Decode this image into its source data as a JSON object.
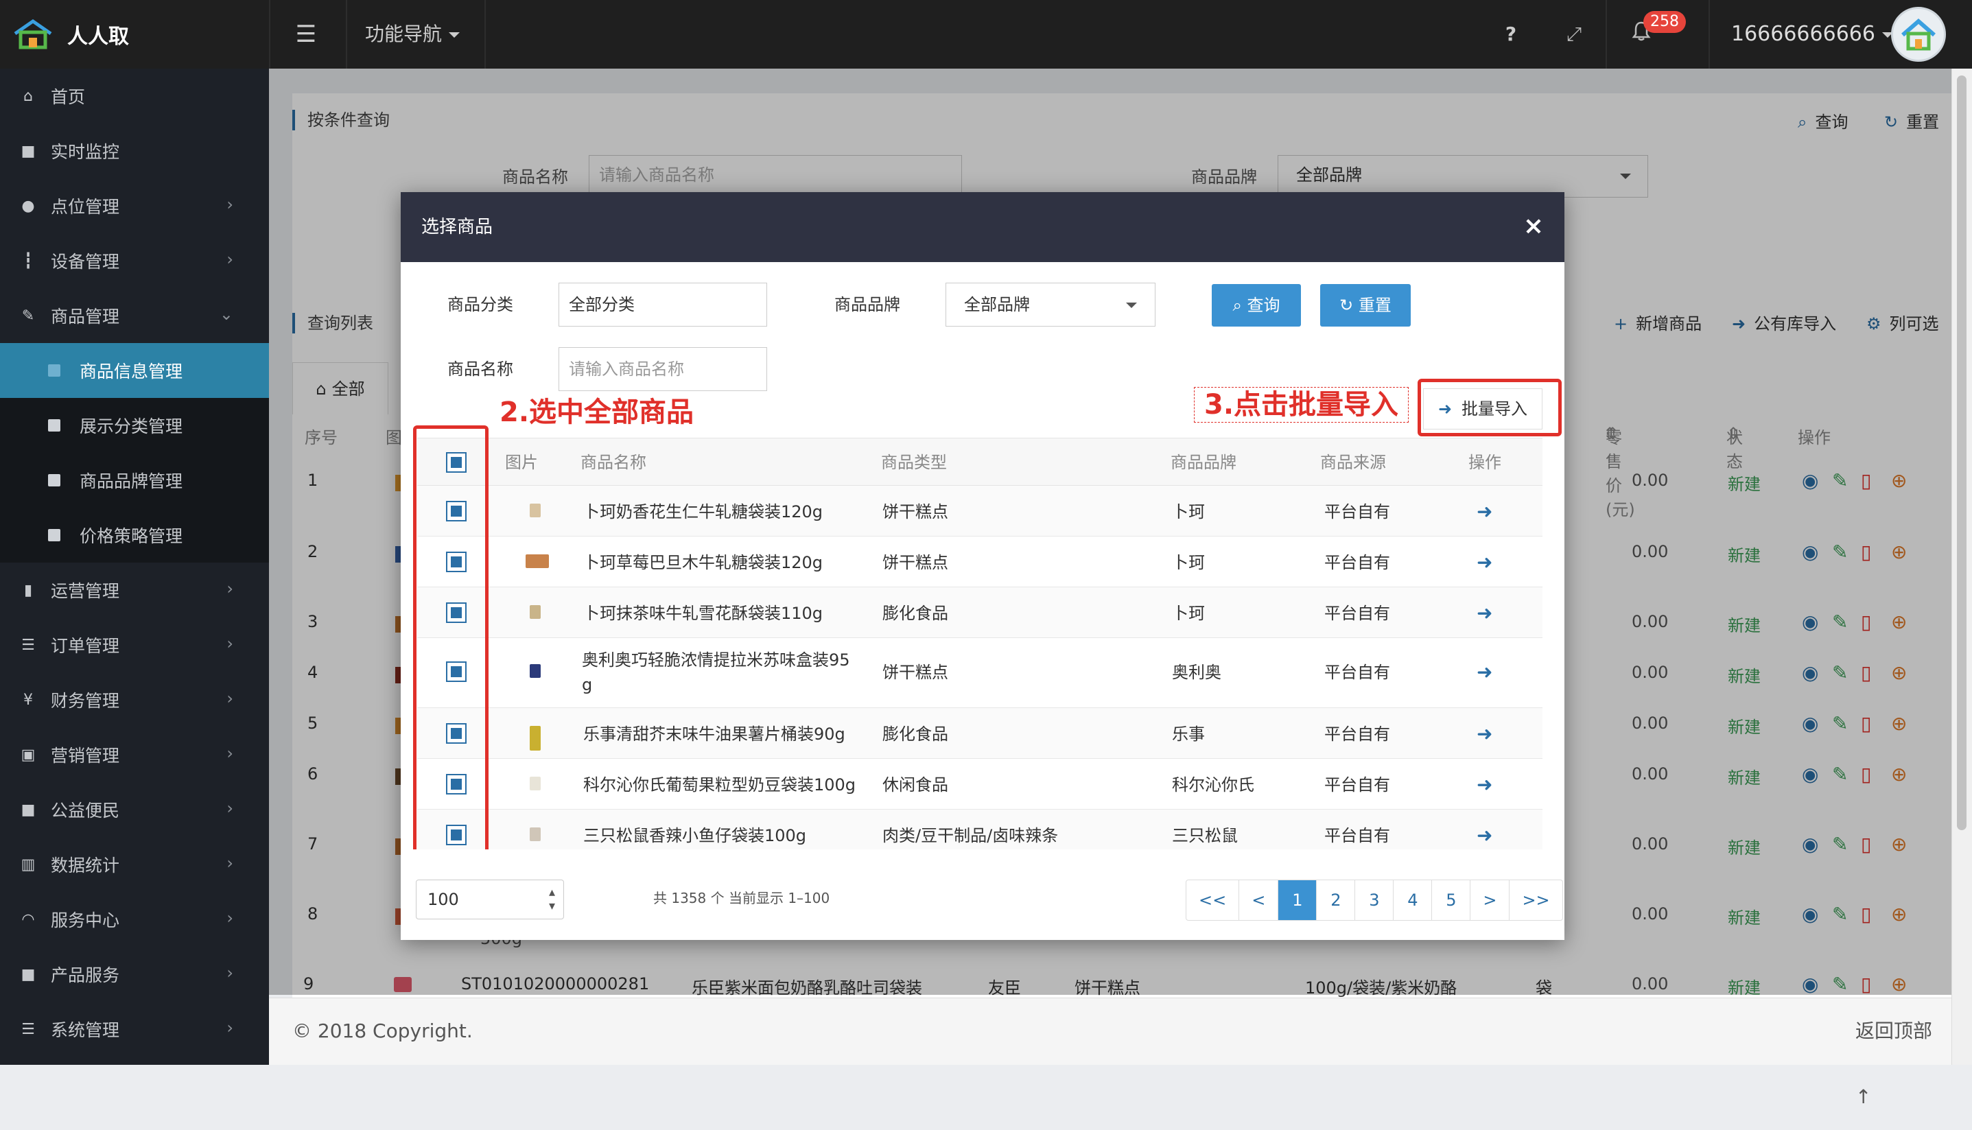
{
  "app": {
    "title": "人人取",
    "nav_menu_label": "功能导航",
    "help_label": "?",
    "notification_count": "258",
    "user_phone": "16666666666"
  },
  "sidebar": {
    "items": [
      {
        "label": "首页",
        "icon": "home-icon"
      },
      {
        "label": "实时监控",
        "icon": "video-icon"
      },
      {
        "label": "点位管理",
        "icon": "location-icon"
      },
      {
        "label": "设备管理",
        "icon": "device-icon"
      },
      {
        "label": "商品管理",
        "icon": "edit-icon"
      },
      {
        "label": "商品信息管理",
        "sub": true,
        "active": true
      },
      {
        "label": "展示分类管理",
        "sub": true
      },
      {
        "label": "商品品牌管理",
        "sub": true
      },
      {
        "label": "价格策略管理",
        "sub": true
      },
      {
        "label": "运营管理",
        "icon": "bookmark-icon"
      },
      {
        "label": "订单管理",
        "icon": "list-icon"
      },
      {
        "label": "财务管理",
        "icon": "yen-icon"
      },
      {
        "label": "营销管理",
        "icon": "gift-icon"
      },
      {
        "label": "公益便民",
        "icon": "square-icon"
      },
      {
        "label": "数据统计",
        "icon": "chart-icon"
      },
      {
        "label": "服务中心",
        "icon": "headset-icon"
      },
      {
        "label": "产品服务",
        "icon": "square-icon"
      },
      {
        "label": "系统管理",
        "icon": "sliders-icon"
      }
    ]
  },
  "background": {
    "filter_title": "按条件查询",
    "query_label": "查询",
    "reset_label": "重置",
    "product_name_label": "商品名称",
    "product_name_placeholder": "请输入商品名称",
    "product_brand_label": "商品品牌",
    "product_brand_value": "全部品牌",
    "list_title": "查询列表",
    "add_product_label": "新增商品",
    "public_import_label": "公有库导入",
    "columns_label": "列可选",
    "tab_all": "全部",
    "col_index": "序号",
    "col_image": "图",
    "col_retail_price": "零售价(元)",
    "col_status": "状态",
    "col_action": "操作",
    "rows": [
      {
        "index": "1",
        "price": "0.00",
        "status": "新建"
      },
      {
        "index": "2",
        "price": "0.00",
        "status": "新建"
      },
      {
        "index": "3",
        "price": "0.00",
        "status": "新建"
      },
      {
        "index": "4",
        "price": "0.00",
        "status": "新建"
      },
      {
        "index": "5",
        "price": "0.00",
        "status": "新建"
      },
      {
        "index": "6",
        "price": "0.00",
        "status": "新建"
      },
      {
        "index": "7",
        "price": "0.00",
        "status": "新建"
      },
      {
        "index": "8",
        "price": "0.00",
        "status": "新建"
      },
      {
        "index": "9",
        "price": "0.00",
        "status": "新建",
        "code": "ST0101020000000281",
        "name": "乐臣紫米面包奶酪乳酪吐司袋装",
        "brand": "友臣",
        "type": "饼干糕点",
        "spec": "100g/袋装/紫米奶酪",
        "unit": "袋"
      }
    ],
    "row8_extra": "500g"
  },
  "footer": {
    "copyright": "© 2018 Copyright.",
    "back_to_top": "返回顶部"
  },
  "modal": {
    "title": "选择商品",
    "close_label": "×",
    "category_label": "商品分类",
    "category_value": "全部分类",
    "brand_label": "商品品牌",
    "brand_value": "全部品牌",
    "query_button": "查询",
    "reset_button": "重置",
    "name_label": "商品名称",
    "name_placeholder": "请输入商品名称",
    "import_button": "批量导入",
    "annotation_select_all": "2.选中全部商品",
    "annotation_click_import": "3.点击批量导入",
    "columns": {
      "image": "图片",
      "name": "商品名称",
      "type": "商品类型",
      "brand": "商品品牌",
      "source": "商品来源",
      "action": "操作"
    },
    "rows": [
      {
        "name": "卜珂奶香花生仁牛轧糖袋装120g",
        "type": "饼干糕点",
        "brand": "卜珂",
        "source": "平台自有"
      },
      {
        "name": "卜珂草莓巴旦木牛轧糖袋装120g",
        "type": "饼干糕点",
        "brand": "卜珂",
        "source": "平台自有"
      },
      {
        "name": "卜珂抹茶味牛轧雪花酥袋装110g",
        "type": "膨化食品",
        "brand": "卜珂",
        "source": "平台自有"
      },
      {
        "name": "奥利奥巧轻脆浓情提拉米苏味盒装95g",
        "name_line1": "奥利奥巧轻脆浓情提拉米苏味盒装95",
        "name_line2": "g",
        "type": "饼干糕点",
        "brand": "奥利奥",
        "source": "平台自有"
      },
      {
        "name": "乐事清甜芥末味牛油果薯片桶装90g",
        "type": "膨化食品",
        "brand": "乐事",
        "source": "平台自有"
      },
      {
        "name": "科尔沁你氏葡萄果粒型奶豆袋装100g",
        "type": "休闲食品",
        "brand": "科尔沁你氏",
        "source": "平台自有"
      },
      {
        "name": "三只松鼠香辣小鱼仔袋装100g",
        "type": "肉类/豆干制品/卤味辣条",
        "brand": "三只松鼠",
        "source": "平台自有"
      }
    ],
    "page_size": "100",
    "page_info": "共 1358 个 当前显示 1–100",
    "pager": [
      "<<",
      "<",
      "1",
      "2",
      "3",
      "4",
      "5",
      ">",
      ">>"
    ],
    "current_page": "1"
  }
}
